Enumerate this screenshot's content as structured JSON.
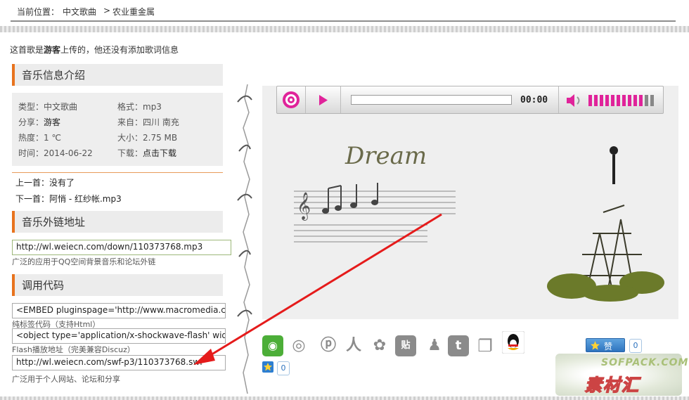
{
  "breadcrumb": {
    "prefix": "当前位置：",
    "category": "中文歌曲",
    "separator": ">",
    "current": "农业重金属"
  },
  "upload_note": {
    "pre": "这首歌是",
    "user": "游客",
    "post": "上传的，他还没有添加歌词信息"
  },
  "sections": {
    "info": "音乐信息介绍",
    "link": "音乐外链地址",
    "code": "调用代码"
  },
  "info": {
    "type": "类型：中文歌曲",
    "format": "格式：mp3",
    "share_label": "分享：",
    "share_user": "游客",
    "from": "来自：四川 南充",
    "heat": "热度：1 ℃",
    "size": "大小：2.75 MB",
    "time": "时间：2014-06-22",
    "download_label": "下载：",
    "download_link": "点击下载"
  },
  "nav": {
    "prev_label": "上一首：",
    "prev_value": "没有了",
    "next_label": "下一首：",
    "next_value": "阿悄 - 红纱帐.mp3"
  },
  "link": {
    "url": "http://wl.weiecn.com/down/110373768.mp3",
    "hint": "广泛的应用于QQ空间背景音乐和论坛外链"
  },
  "code": {
    "embed": "<EMBED pluginspage='http://www.macromedia.com",
    "embed_hint": "纯标签代码（支持Html）",
    "object": "<object type='application/x-shockwave-flash' width='",
    "object_hint": "Flash播放地址（完美兼容Discuz）",
    "swf": "http://wl.weiecn.com/swf-p3/110373768.swf",
    "swf_hint": "广泛用于个人网站、论坛和分享"
  },
  "player": {
    "time": "00:00",
    "cover_text": "Dream",
    "volume_level": 0.8
  },
  "share": {
    "like_label": "赞",
    "like_count": "0",
    "small_count": "0"
  },
  "watermark": {
    "top": "SOFPACK.COM",
    "bottom": "素材汇"
  },
  "colors": {
    "accent": "#e8731e",
    "player_pink": "#e0239a",
    "link_blue": "#2e74bf",
    "arrow_red": "#e51b1b"
  }
}
